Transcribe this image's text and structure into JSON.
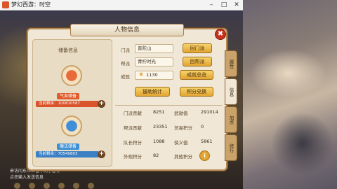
{
  "window": {
    "title": "梦幻西游：时空"
  },
  "panel": {
    "title": "人物信息",
    "close_label": "✖"
  },
  "storage": {
    "title": "储备信息",
    "hp_label": "气血储备",
    "hp_remaining": "当前剩余：100810587",
    "mp_label": "魔法储备",
    "mp_remaining": "当前剩余：70540803"
  },
  "info": {
    "sect_label": "门派",
    "sect_value": "普陀山",
    "faction_label": "帮派",
    "faction_value": "青柠时光",
    "achieve_label": "成就",
    "achieve_value": "1130",
    "btn_return_sect": "回门派",
    "btn_return_faction": "回帮派",
    "btn_achieve_total": "成就总览",
    "btn_help_stats": "援助统计",
    "btn_points_exchange": "积分兑换"
  },
  "stats": [
    {
      "label": "门派贡献",
      "value": "8251",
      "label2": "武勋值",
      "value2": "291014"
    },
    {
      "label": "帮派贡献",
      "value": "23351",
      "label2": "贸易积分",
      "value2": "0"
    },
    {
      "label": "队长积分",
      "value": "1088",
      "label2": "侠义值",
      "value2": "5861"
    },
    {
      "label": "外观积分",
      "value": "82",
      "label2": "其他积分",
      "value2": ""
    }
  ],
  "tabs": [
    "属性",
    "信息",
    "加点",
    "修行"
  ],
  "chat": {
    "line1": "来访问东三王看不到了@你",
    "line2": "点击输入发送信息"
  },
  "colors": {
    "panel_bg": "#f0e7d6",
    "button_gold": "#e2a532",
    "close_red": "#c8321f"
  }
}
